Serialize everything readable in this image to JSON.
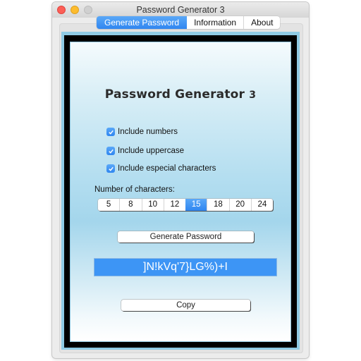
{
  "window": {
    "title": "Password Generator 3"
  },
  "tabs": [
    {
      "label": "Generate Password",
      "active": true
    },
    {
      "label": "Information",
      "active": false
    },
    {
      "label": "About",
      "active": false
    }
  ],
  "main": {
    "title_text": "Password Generator ",
    "title_version": "3",
    "options": [
      {
        "label": "Include numbers",
        "checked": true
      },
      {
        "label": "Include uppercase",
        "checked": true
      },
      {
        "label": "Include especial characters",
        "checked": true
      }
    ],
    "length_label": "Number of characters:",
    "length_options": [
      "5",
      "8",
      "10",
      "12",
      "15",
      "18",
      "20",
      "24"
    ],
    "length_selected": "15",
    "generate_label": "Generate Password",
    "password": "]N!kVq'7}LG%)+I",
    "copy_label": "Copy"
  },
  "colors": {
    "accent": "#3d95f5",
    "frame": "#8fcbe5"
  }
}
